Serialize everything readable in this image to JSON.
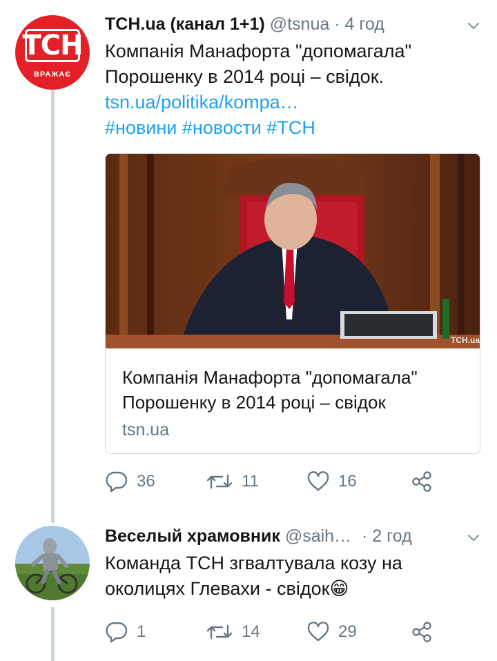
{
  "tweets": [
    {
      "avatar_text": "ТСН",
      "avatar_subtext": "ВРАЖАЄ",
      "name": "ТСН.ua (канал 1+1)",
      "handle": "@tsnua",
      "dot": "·",
      "time": "4 год",
      "text_line1": "Компанія Манафорта \"допомагала\"",
      "text_line2": "Порошенку в 2014 році – свідок.",
      "link": "tsn.ua/politika/kompa…",
      "hashtags": "#новини #новости #ТСН",
      "card": {
        "title": "Компанія Манафорта \"допомагала\" Порошенку в 2014 році – свідок",
        "domain": "tsn.ua",
        "watermark": "ТСН.ua"
      },
      "actions": {
        "replies": "36",
        "retweets": "11",
        "likes": "16"
      }
    },
    {
      "name": "Веселый храмовник",
      "handle": "@saih…",
      "dot": "·",
      "time": "2 год",
      "text_line1": "Команда ТСН згвалтувала козу на",
      "text_line2": "околицях Глевахи - свідок",
      "emoji": "😁",
      "actions": {
        "replies": "1",
        "retweets": "14",
        "likes": "29"
      }
    }
  ],
  "colors": {
    "accent": "#1da1f2",
    "muted": "#657786",
    "tsn_red": "#e32028"
  },
  "icons": [
    "reply-icon",
    "retweet-icon",
    "like-icon",
    "share-icon",
    "chevron-down-icon"
  ]
}
